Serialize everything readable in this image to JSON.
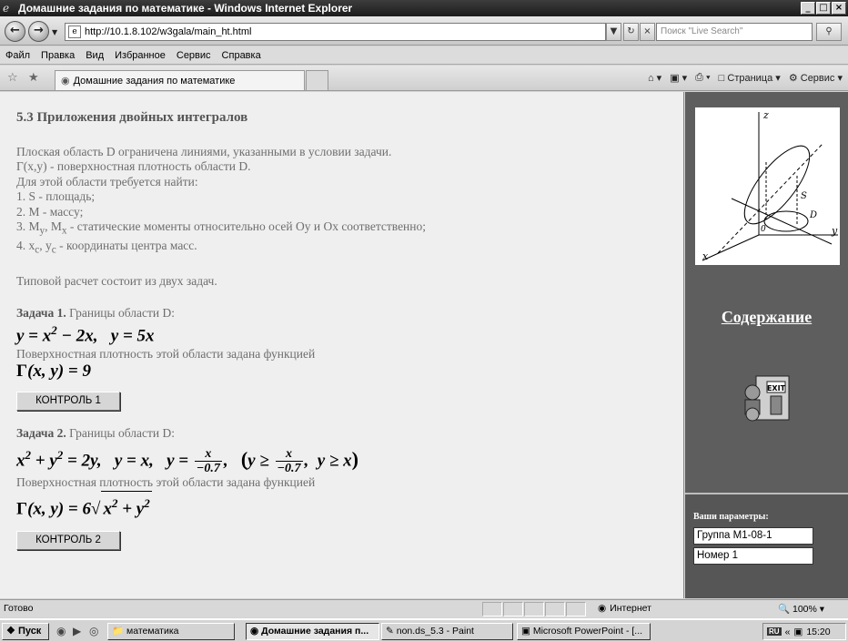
{
  "window": {
    "title": "Домашние задания по математике - Windows Internet Explorer",
    "min": "_",
    "max": "□",
    "close": "×"
  },
  "nav": {
    "url": "http://10.1.8.102/w3gala/main_ht.html",
    "search_placeholder": "Поиск \"Live Search\""
  },
  "menu": [
    "Файл",
    "Правка",
    "Вид",
    "Избранное",
    "Сервис",
    "Справка"
  ],
  "tabs": {
    "active_label": "Домашние задания по математике",
    "page_menu": "Страница",
    "tools_menu": "Сервис"
  },
  "main": {
    "heading": "5.3 Приложения двойных интегралов",
    "intro": [
      "Плоская область D ограничена линиями, указанными в условии задачи.",
      "Γ(x,y) - поверхностная плотность области D.",
      "Для этой области требуется найти:",
      "1. S - площадь;",
      "2. M - массу;"
    ],
    "item3": {
      "pre": "3. M",
      "sub1": "y",
      "mid": ", M",
      "sub2": "x",
      "post": " - статические моменты относительно осей Oy и Ox соответственно;"
    },
    "item4": {
      "pre": "4. x",
      "sub1": "c",
      "mid": ", y",
      "sub2": "c",
      "post": " - координаты центра масс."
    },
    "typical": "Типовой расчет состоит из двух задач.",
    "task1": {
      "title": "Задача 1.",
      "text": " Границы области D:",
      "density_text": "Поверхностная плотность этой области задана функцией",
      "button": "КОНТРОЛЬ 1"
    },
    "task2": {
      "title": "Задача 2.",
      "text": " Границы области D:",
      "density_text": "Поверхностная плотность этой области задана функцией",
      "button": "КОНТРОЛЬ 2"
    }
  },
  "sidebar": {
    "contents_link": "Содержание",
    "params_label": "Ваши параметры:",
    "group": "Группа М1-08-1",
    "number": "Номер 1",
    "axis_z": "z",
    "axis_y": "y",
    "axis_x": "x",
    "label_s": "S",
    "label_d": "D",
    "label_o": "0",
    "exit_text": "EXIT"
  },
  "status": {
    "text": "Готово",
    "zone": "Интернет",
    "zoom": "100%"
  },
  "taskbar": {
    "start": "Пуск",
    "tasks": [
      "математика",
      "Домашние задания п...",
      "non.ds_5.3 - Paint",
      "Microsoft PowerPoint - [..."
    ],
    "lang": "RU",
    "time": "15:20"
  }
}
